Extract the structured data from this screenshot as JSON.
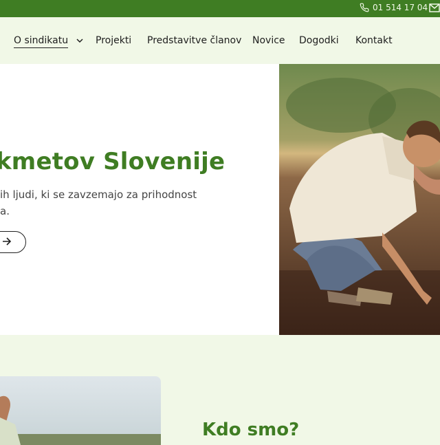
{
  "topbar": {
    "phone": "01 514 17 04",
    "phone_icon": "phone-icon",
    "mail_icon": "mail-icon"
  },
  "nav": {
    "items": [
      {
        "label": "O sindikatu",
        "has_dropdown": true,
        "active": true
      },
      {
        "label": "Projekti"
      },
      {
        "label": "Predstavitve članov"
      },
      {
        "label": "Novice"
      },
      {
        "label": "Dogodki"
      },
      {
        "label": "Kontakt"
      }
    ]
  },
  "hero": {
    "title": "kmetov Slovenije",
    "subtitle_line1": "ih ljudi, ki se zavzemajo za prihodnost",
    "subtitle_line2": "a.",
    "button_icon": "arrow-right-icon"
  },
  "about": {
    "heading": "Kdo smo?"
  },
  "colors": {
    "brand_green": "#3f7d23",
    "light_bg": "#f1f8e7"
  }
}
